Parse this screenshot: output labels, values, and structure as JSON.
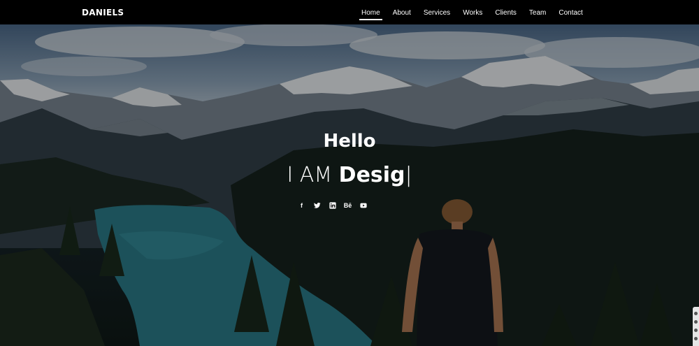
{
  "brand": "DANIELS",
  "nav": [
    {
      "label": "Home",
      "active": true
    },
    {
      "label": "About",
      "active": false
    },
    {
      "label": "Services",
      "active": false
    },
    {
      "label": "Works",
      "active": false
    },
    {
      "label": "Clients",
      "active": false
    },
    {
      "label": "Team",
      "active": false
    },
    {
      "label": "Contact",
      "active": false
    }
  ],
  "hero": {
    "title": "Hello",
    "subtitle_prefix": "I AM ",
    "subtitle_typed": "Desig",
    "cursor": "|"
  },
  "socials": [
    {
      "name": "facebook-icon",
      "glyph": "f"
    },
    {
      "name": "twitter-icon",
      "glyph": ""
    },
    {
      "name": "linkedin-icon",
      "glyph": "in"
    },
    {
      "name": "behance-icon",
      "glyph": "Bē"
    },
    {
      "name": "youtube-icon",
      "glyph": ""
    }
  ],
  "colors": {
    "navbar_bg": "#000000",
    "text": "#ffffff"
  }
}
